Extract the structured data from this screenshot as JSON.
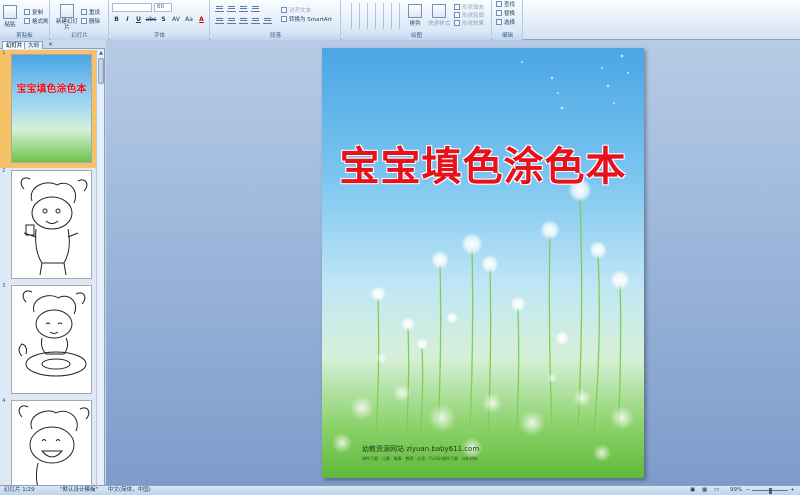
{
  "ribbon": {
    "clipboard": {
      "label": "剪贴板",
      "paste": "粘贴",
      "copy": "复制",
      "format_painter": "格式刷"
    },
    "slides": {
      "label": "幻灯片",
      "new_slide": "新建幻灯片",
      "reset": "重设",
      "delete": "删除"
    },
    "font": {
      "label": "字体",
      "size": "60",
      "bold": "B",
      "italic": "I",
      "underline": "U",
      "strike": "abc",
      "shadow": "S",
      "spacing": "AV",
      "case": "Aa",
      "color": "A"
    },
    "paragraph": {
      "label": "段落",
      "align_text": "对齐文本",
      "convert_smartart": "转换为 SmartArt"
    },
    "drawing": {
      "label": "绘图",
      "arrange": "排列",
      "quick_styles": "快速样式",
      "shape_fill": "形状填充",
      "shape_outline": "形状轮廓",
      "shape_effects": "形状效果"
    },
    "editing": {
      "label": "编辑",
      "find": "查找",
      "replace": "替换",
      "select": "选择"
    }
  },
  "panel": {
    "tabs": [
      {
        "label": "幻灯片"
      },
      {
        "label": "大纲"
      }
    ],
    "close": "×",
    "thumbnails": [
      {
        "number": "1",
        "title": "宝宝填色涂色本"
      },
      {
        "number": "2"
      },
      {
        "number": "3"
      },
      {
        "number": "4"
      }
    ]
  },
  "slide": {
    "title": "宝宝填色涂色本",
    "footer": "幼教资源网站  ziyuan.baby611.com",
    "footer_sub": "课件下载 · 儿歌 · 故事 · 教案 · 反思 · FLASH课件下载 · 分析材料"
  },
  "statusbar": {
    "slide_count": "幻灯片 1/29",
    "theme": "\"默认设计模板\"",
    "language": "中文(简体，中国)",
    "zoom": "99%"
  }
}
